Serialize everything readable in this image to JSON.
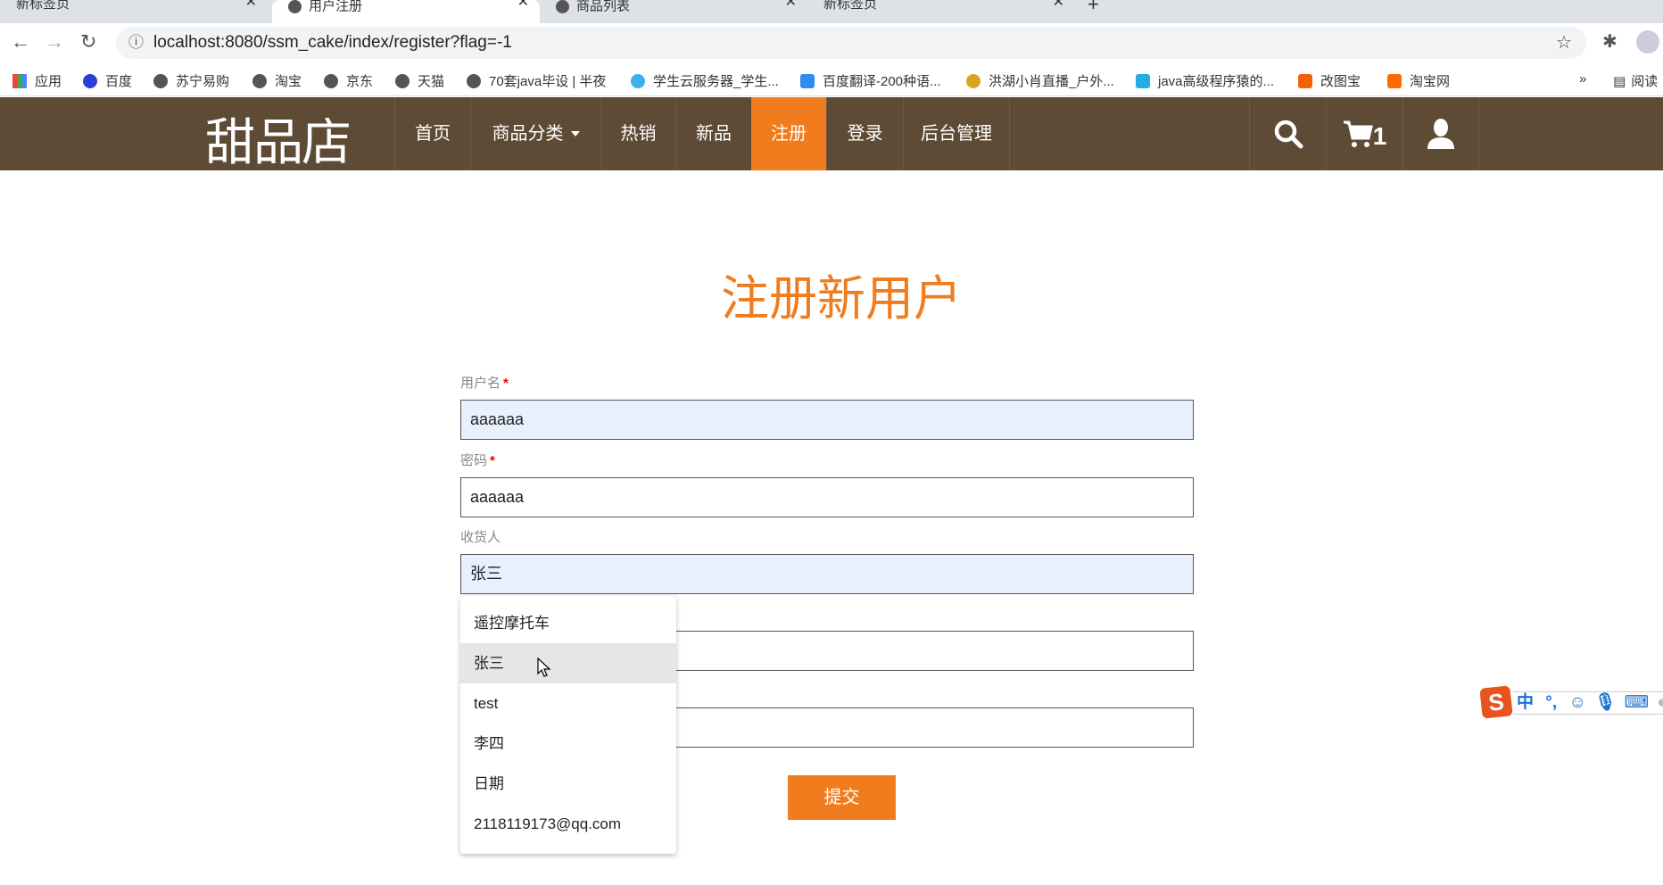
{
  "browser": {
    "tabs": [
      {
        "label": "新标签页"
      },
      {
        "label": "用户注册",
        "active": true
      },
      {
        "label": "商品列表"
      },
      {
        "label": "新标签页"
      }
    ],
    "url": "localhost:8080/ssm_cake/index/register?flag=-1",
    "bookmarks": [
      "应用",
      "百度",
      "苏宁易购",
      "淘宝",
      "京东",
      "天猫",
      "70套java毕设 | 半夜",
      "学生云服务器_学生...",
      "百度翻译-200种语...",
      "洪湖小肖直播_户外...",
      "java高级程序猿的...",
      "改图宝",
      "淘宝网"
    ],
    "reading_list": "阅读"
  },
  "navbar": {
    "logo": "甜品店",
    "items": [
      "首页",
      "商品分类",
      "热销",
      "新品",
      "注册",
      "登录",
      "后台管理"
    ],
    "active": "注册",
    "cart_count": "1"
  },
  "page": {
    "title": "注册新用户",
    "fields": [
      {
        "label": "用户名",
        "required": "*",
        "value": "aaaaaa"
      },
      {
        "label": "密码",
        "required": "*",
        "value": "aaaaaa"
      },
      {
        "label": "收货人",
        "value": "张三"
      },
      {
        "value": ""
      },
      {
        "value": ""
      }
    ],
    "submit": "提交",
    "autocomplete": [
      "遥控摩托车",
      "张三",
      "test",
      "李四",
      "日期",
      "2118119173@qq.com"
    ]
  },
  "ime": {
    "logo": "S",
    "mode": "中",
    "punct": "°,"
  },
  "colors": {
    "navbar": "#5e4b35",
    "accent": "#f07c1e",
    "autofill": "#e8f0fe"
  }
}
